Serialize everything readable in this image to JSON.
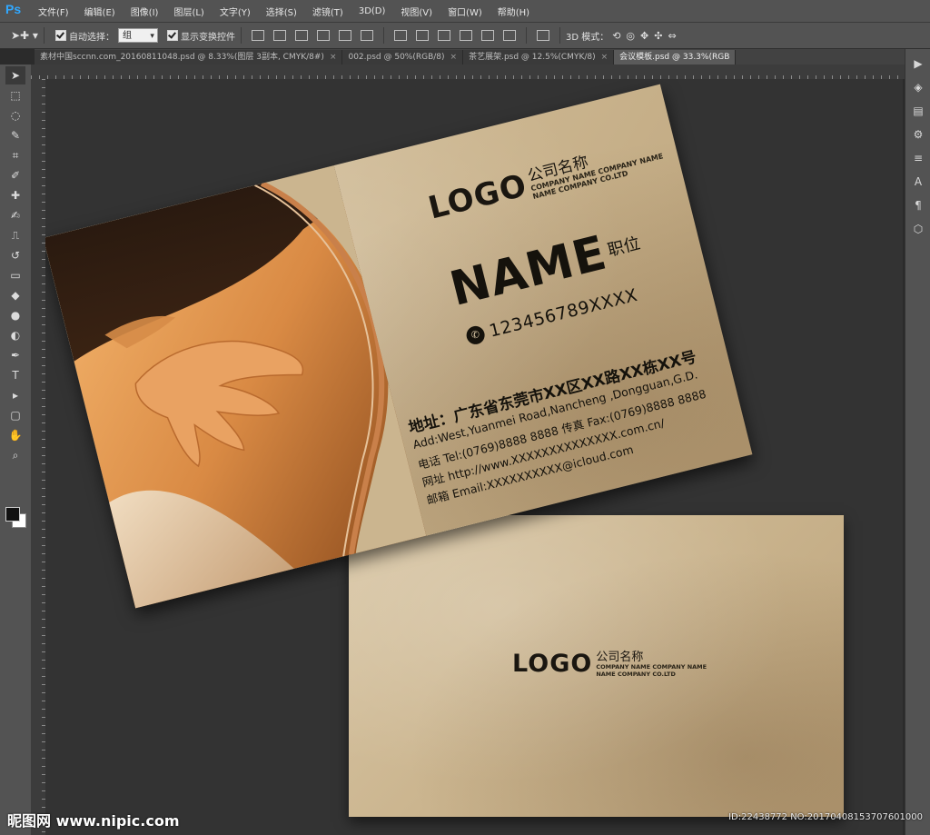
{
  "menu": {
    "app_logo": "Ps",
    "items": [
      "文件(F)",
      "编辑(E)",
      "图像(I)",
      "图层(L)",
      "文字(Y)",
      "选择(S)",
      "滤镜(T)",
      "3D(D)",
      "视图(V)",
      "窗口(W)",
      "帮助(H)"
    ]
  },
  "options": {
    "auto_select_label": "自动选择：",
    "auto_select_value": "组",
    "show_transform_label": "显示变换控件",
    "mode_3d_label": "3D 模式："
  },
  "tabs": [
    {
      "label": "素材中国sccnn.com_20160811048.psd @ 8.33%(图层 3副本, CMYK/8#)",
      "active": false
    },
    {
      "label": "002.psd @ 50%(RGB/8)",
      "active": false
    },
    {
      "label": "茶艺展架.psd @ 12.5%(CMYK/8)",
      "active": false
    },
    {
      "label": "会议模板.psd @ 33.3%(RGB",
      "active": true
    }
  ],
  "tab_close_glyph": "×",
  "tools": [
    "move-tool",
    "marquee-tool",
    "lasso-tool",
    "quick-select-tool",
    "crop-tool",
    "eyedropper-tool",
    "healing-tool",
    "brush-tool",
    "clone-stamp-tool",
    "history-brush-tool",
    "eraser-tool",
    "paint-bucket-tool",
    "blur-tool",
    "dodge-tool",
    "pen-tool",
    "type-tool",
    "path-select-tool",
    "shape-tool",
    "hand-tool",
    "zoom-tool"
  ],
  "tool_glyphs": [
    "➤",
    "⬚",
    "◌",
    "✎",
    "⌗",
    "✐",
    "✚",
    "✍",
    "⎍",
    "↺",
    "▭",
    "◆",
    "●",
    "◐",
    "✒",
    "T",
    "▸",
    "▢",
    "✋",
    "⌕"
  ],
  "right_panel_glyphs": [
    "▶",
    "◈",
    "▤",
    "⚙",
    "≡",
    "A",
    "¶",
    "⬡"
  ],
  "colors": {
    "foreground": "#111111",
    "background": "#ffffff",
    "accent_copper": "#c9804a"
  },
  "card_front": {
    "logo": "LOGO",
    "company_cn": "公司名称",
    "company_en_1": "COMPANY NAME COMPANY NAME",
    "company_en_2": "NAME COMPANY CO.LTD",
    "name": "NAME",
    "title": "职位",
    "phone": "123456789XXXX",
    "address_label": "地址：",
    "address_cn": "广东省东莞市XX区XX路XX栋XX号",
    "address_en": "Add:West,Yuanmei Road,Nancheng ,Dongguan,G.D.",
    "tel_line": "电话 Tel:(0769)8888 8888  传真 Fax:(0769)8888 8888",
    "web_line": "网址 http://www.XXXXXXXXXXXXXX.com.cn/",
    "email_line": "邮箱 Email:XXXXXXXXXX@icloud.com"
  },
  "card_back": {
    "logo": "LOGO",
    "company_cn": "公司名称",
    "company_en_1": "COMPANY NAME COMPANY NAME",
    "company_en_2": "NAME COMPANY CO.LTD"
  },
  "watermark": {
    "left": "昵图网 www.nipic.com",
    "right": "ID:22438772 NO:20170408153707601000"
  }
}
